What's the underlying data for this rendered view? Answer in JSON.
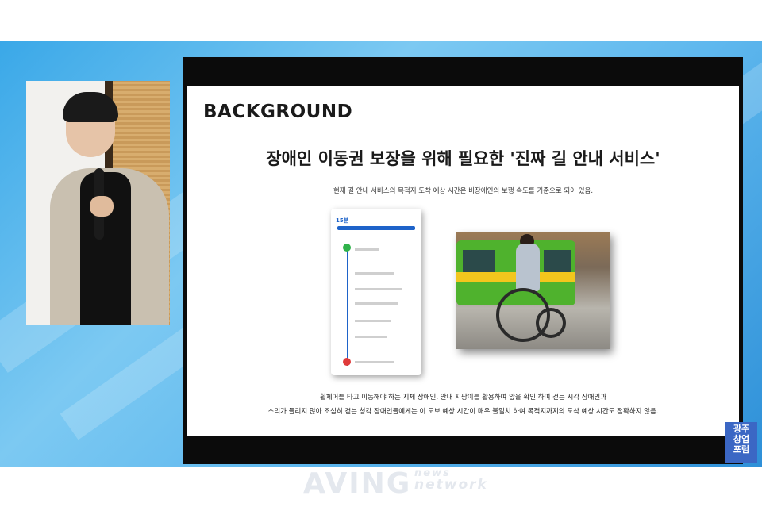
{
  "slide": {
    "section_title": "BACKGROUND",
    "heading": "장애인 이동권 보장을 위해 필요한 '진짜 길 안내 서비스'",
    "subtitle": "현재 길 안내 서비스의 목적지 도착 예상 시간은 비장애인의 보행 속도를 기준으로 되어 있음.",
    "bottom_line_1": "휠체어를 타고 이동해야 하는 지체 장애인, 안내 지팡이를 활용하여 앞을 확인 하며 걷는 시각 장애인과",
    "bottom_line_2": "소리가 들리지 않아 조심히 걷는 청각 장애인들에게는 이 도보 예상 시간이 매우 불일치 하여 목적지까지의 도착 예상 시간도 정확하지 않음."
  },
  "phone_screenshot": {
    "duration": "15분"
  },
  "watermark": {
    "brand": "AVING",
    "news": "news",
    "network": "network"
  },
  "logo": {
    "lines": [
      "광주",
      "창업",
      "포럼"
    ]
  },
  "colors": {
    "route_blue": "#1e63c9",
    "start_green": "#2fb24a",
    "end_red": "#e03a3a",
    "logo_blue": "#3b67c4"
  }
}
